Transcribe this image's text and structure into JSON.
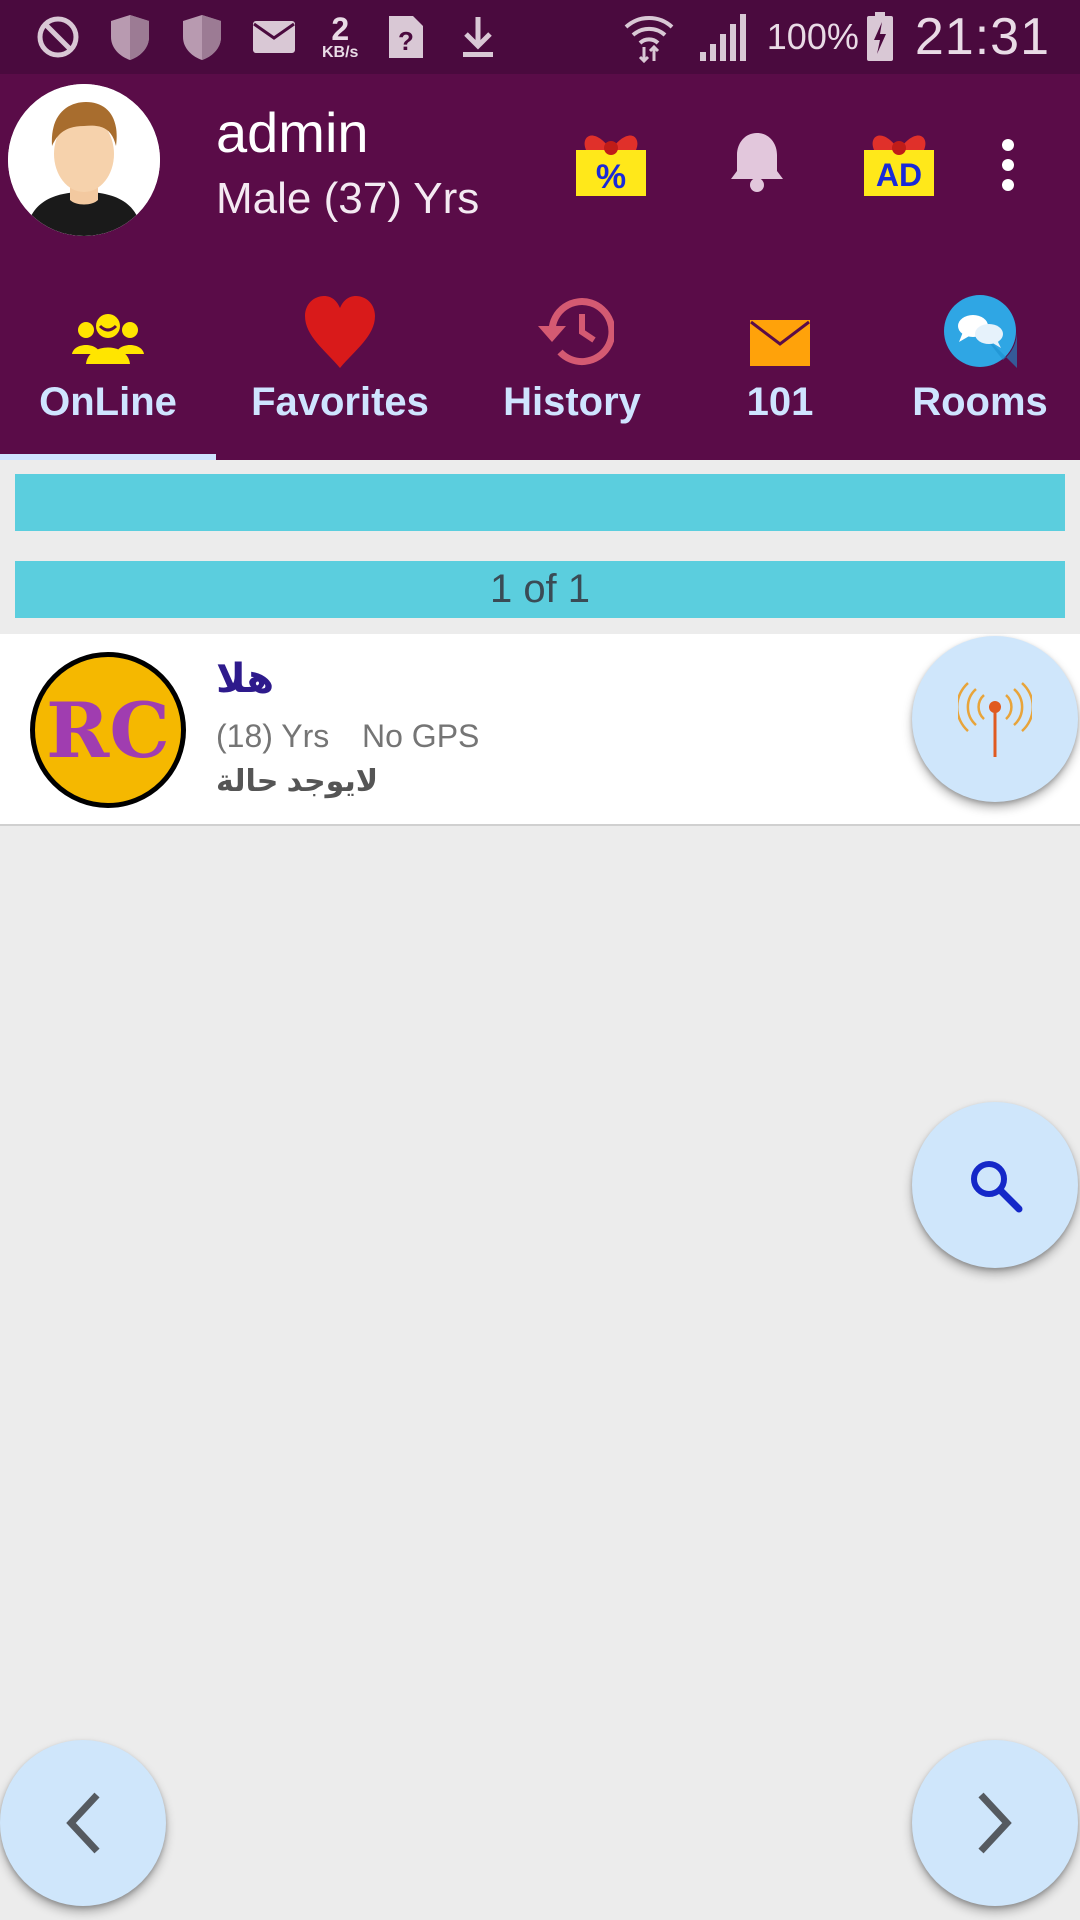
{
  "status_bar": {
    "kbs_value": "2",
    "kbs_unit": "KB/s",
    "battery": "100%",
    "time": "21:31"
  },
  "profile": {
    "name": "admin",
    "info": "Male (37) Yrs"
  },
  "header_actions": {
    "discount_badge": "%",
    "ad_badge": "AD"
  },
  "tabs": [
    {
      "label": "OnLine",
      "icon": "online-users-icon",
      "active": true
    },
    {
      "label": "Favorites",
      "icon": "heart-icon",
      "active": false
    },
    {
      "label": "History",
      "icon": "history-icon",
      "active": false
    },
    {
      "label": "101",
      "icon": "mail-icon",
      "active": false
    },
    {
      "label": "Rooms",
      "icon": "chat-rooms-icon",
      "active": false
    }
  ],
  "banner": {
    "text": "",
    "pagination": "1 of 1"
  },
  "users": [
    {
      "avatar_text": "RC",
      "name": "هلا",
      "age": "(18) Yrs",
      "gps": "No GPS",
      "status": "لايوجد حالة"
    }
  ],
  "colors": {
    "status_bar": "#4a0a3e",
    "header": "#5a0c48",
    "tab_label": "#cfe4ff",
    "banner": "#5bcede",
    "fab": "#cfe6fb",
    "background": "#ececec"
  }
}
